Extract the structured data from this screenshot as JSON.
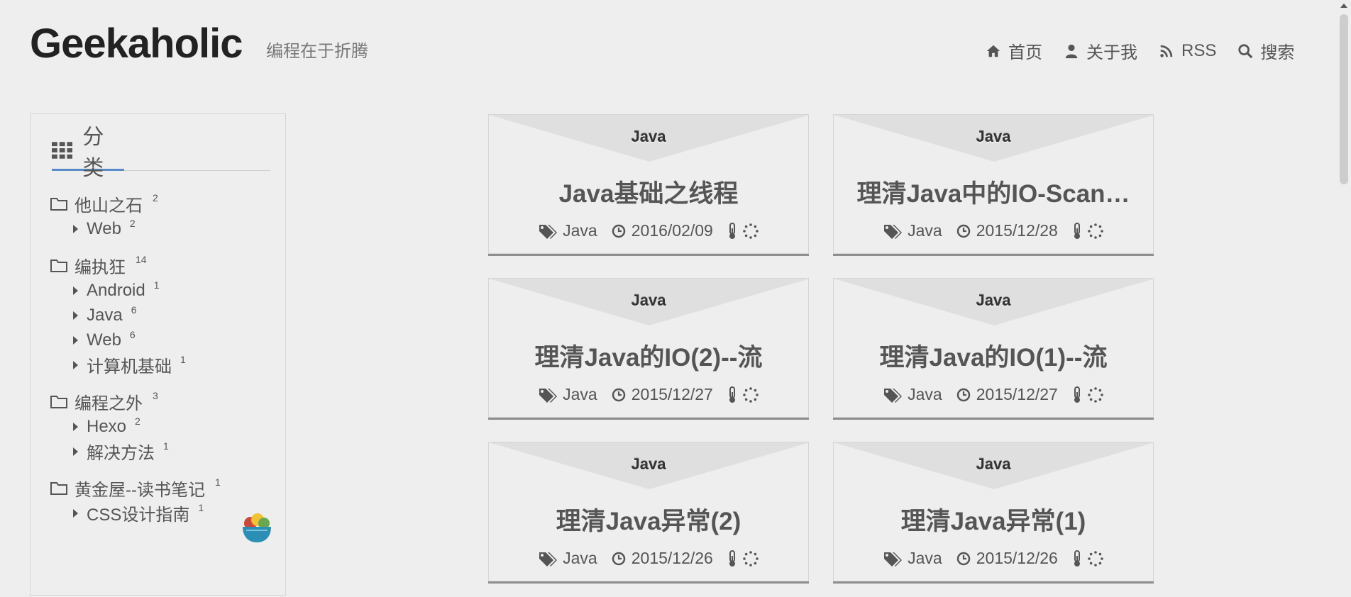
{
  "header": {
    "site_title": "Geekaholic",
    "subtitle": "编程在于折腾",
    "nav": [
      {
        "label": "首页",
        "icon": "home-icon"
      },
      {
        "label": "关于我",
        "icon": "user-icon"
      },
      {
        "label": "RSS",
        "icon": "rss-icon"
      },
      {
        "label": "搜索",
        "icon": "search-icon"
      }
    ]
  },
  "sidebar": {
    "title": "分类",
    "groups": [
      {
        "name": "他山之石",
        "count": "2",
        "children": [
          {
            "name": "Web",
            "count": "2"
          }
        ]
      },
      {
        "name": "编执狂",
        "count": "14",
        "children": [
          {
            "name": "Android",
            "count": "1"
          },
          {
            "name": "Java",
            "count": "6"
          },
          {
            "name": "Web",
            "count": "6"
          },
          {
            "name": "计算机基础",
            "count": "1"
          }
        ]
      },
      {
        "name": "编程之外",
        "count": "3",
        "children": [
          {
            "name": "Hexo",
            "count": "2"
          },
          {
            "name": "解决方法",
            "count": "1"
          }
        ]
      },
      {
        "name": "黄金屋--读书笔记",
        "count": "1",
        "children": [
          {
            "name": "CSS设计指南",
            "count": "1"
          }
        ]
      }
    ]
  },
  "posts": [
    {
      "category": "Java",
      "title": "Java基础之线程",
      "tag": "Java",
      "date": "2016/02/09"
    },
    {
      "category": "Java",
      "title": "理清Java中的IO-Scan…",
      "tag": "Java",
      "date": "2015/12/28"
    },
    {
      "category": "Java",
      "title": "理清Java的IO(2)--流",
      "tag": "Java",
      "date": "2015/12/27"
    },
    {
      "category": "Java",
      "title": "理清Java的IO(1)--流",
      "tag": "Java",
      "date": "2015/12/27"
    },
    {
      "category": "Java",
      "title": "理清Java异常(2)",
      "tag": "Java",
      "date": "2015/12/26"
    },
    {
      "category": "Java",
      "title": "理清Java异常(1)",
      "tag": "Java",
      "date": "2015/12/26"
    }
  ],
  "colors": {
    "background": "#eeeeee",
    "accent_underline": "#5a8dc8",
    "text": "#555555"
  }
}
